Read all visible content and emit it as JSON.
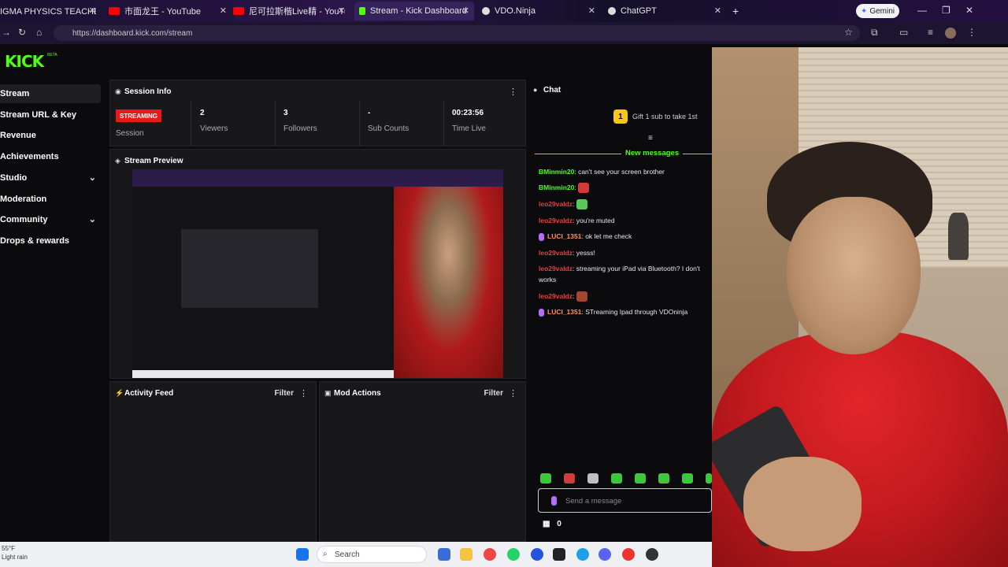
{
  "browser": {
    "tabs": [
      {
        "label": "IGMA PHYSICS TEACHER 🎓 |",
        "color": "#ffffff"
      },
      {
        "label": "市面龙王 - YouTube",
        "color": "#ff0000"
      },
      {
        "label": "尼可拉斯楷Live精 - YouTube",
        "color": "#ff0000"
      },
      {
        "label": "Stream - Kick Dashboard",
        "color": "#53fc18"
      },
      {
        "label": "VDO.Ninja",
        "color": "#ffffff"
      },
      {
        "label": "ChatGPT",
        "color": "#ffffff"
      }
    ],
    "new_tab": "+",
    "gemini_label": "Gemini",
    "url": "https://dashboard.kick.com/stream"
  },
  "kick": {
    "logo": "KICK",
    "beta": "BETA"
  },
  "sidebar": {
    "items": [
      {
        "label": "Stream",
        "active": true
      },
      {
        "label": "Stream URL & Key"
      },
      {
        "label": "Revenue"
      },
      {
        "label": "Achievements"
      },
      {
        "label": "Studio",
        "chevron": true
      },
      {
        "label": "Moderation"
      },
      {
        "label": "Community",
        "chevron": true
      },
      {
        "label": "Drops & rewards"
      }
    ]
  },
  "session": {
    "title": "Session Info",
    "status_badge": "STREAMING",
    "status_label": "Session",
    "stats": [
      {
        "value": "2",
        "label": "Viewers"
      },
      {
        "value": "3",
        "label": "Followers"
      },
      {
        "value": "-",
        "label": "Sub Counts"
      },
      {
        "value": "00:23:56",
        "label": "Time Live"
      }
    ]
  },
  "preview": {
    "title": "Stream Preview"
  },
  "activity": {
    "title": "Activity Feed",
    "filter": "Filter"
  },
  "modactions": {
    "title": "Mod Actions",
    "filter": "Filter"
  },
  "chat": {
    "title": "Chat",
    "gift_count": "1",
    "gift_text": "Gift 1 sub to take 1st",
    "new_messages": "New messages",
    "messages": [
      {
        "user": "BMinmin20",
        "color": "#53fc18",
        "text": ": can't see your screen brother",
        "emote": ""
      },
      {
        "user": "BMinmin20",
        "color": "#53fc18",
        "text": ": ",
        "emote": "#d33a3a"
      },
      {
        "user": "leo29valdz",
        "color": "#e34141",
        "text": ": ",
        "emote": "#5cc85c"
      },
      {
        "user": "leo29valdz",
        "color": "#e34141",
        "text": ": you're muted",
        "emote": ""
      },
      {
        "user": "LUCI_1351",
        "color": "#ff8c5a",
        "text": ": ok let me check",
        "emote": "",
        "mic": true
      },
      {
        "user": "leo29valdz",
        "color": "#e34141",
        "text": ": yesss!",
        "emote": ""
      },
      {
        "user": "leo29valdz",
        "color": "#e34141",
        "text": ": streaming your iPad via Bluetooth? I don't works",
        "emote": ""
      },
      {
        "user": "leo29valdz",
        "color": "#e34141",
        "text": ": ",
        "emote": "#a5452f"
      },
      {
        "user": "LUCI_1351",
        "color": "#ff8c5a",
        "text": ": STreaming Ipad through VDOninja",
        "emote": "",
        "mic": true
      }
    ],
    "input_placeholder": "Send a message",
    "chest_count": "0"
  },
  "taskbar": {
    "temp": "55°F",
    "weather": "Light rain",
    "search": "Search"
  }
}
